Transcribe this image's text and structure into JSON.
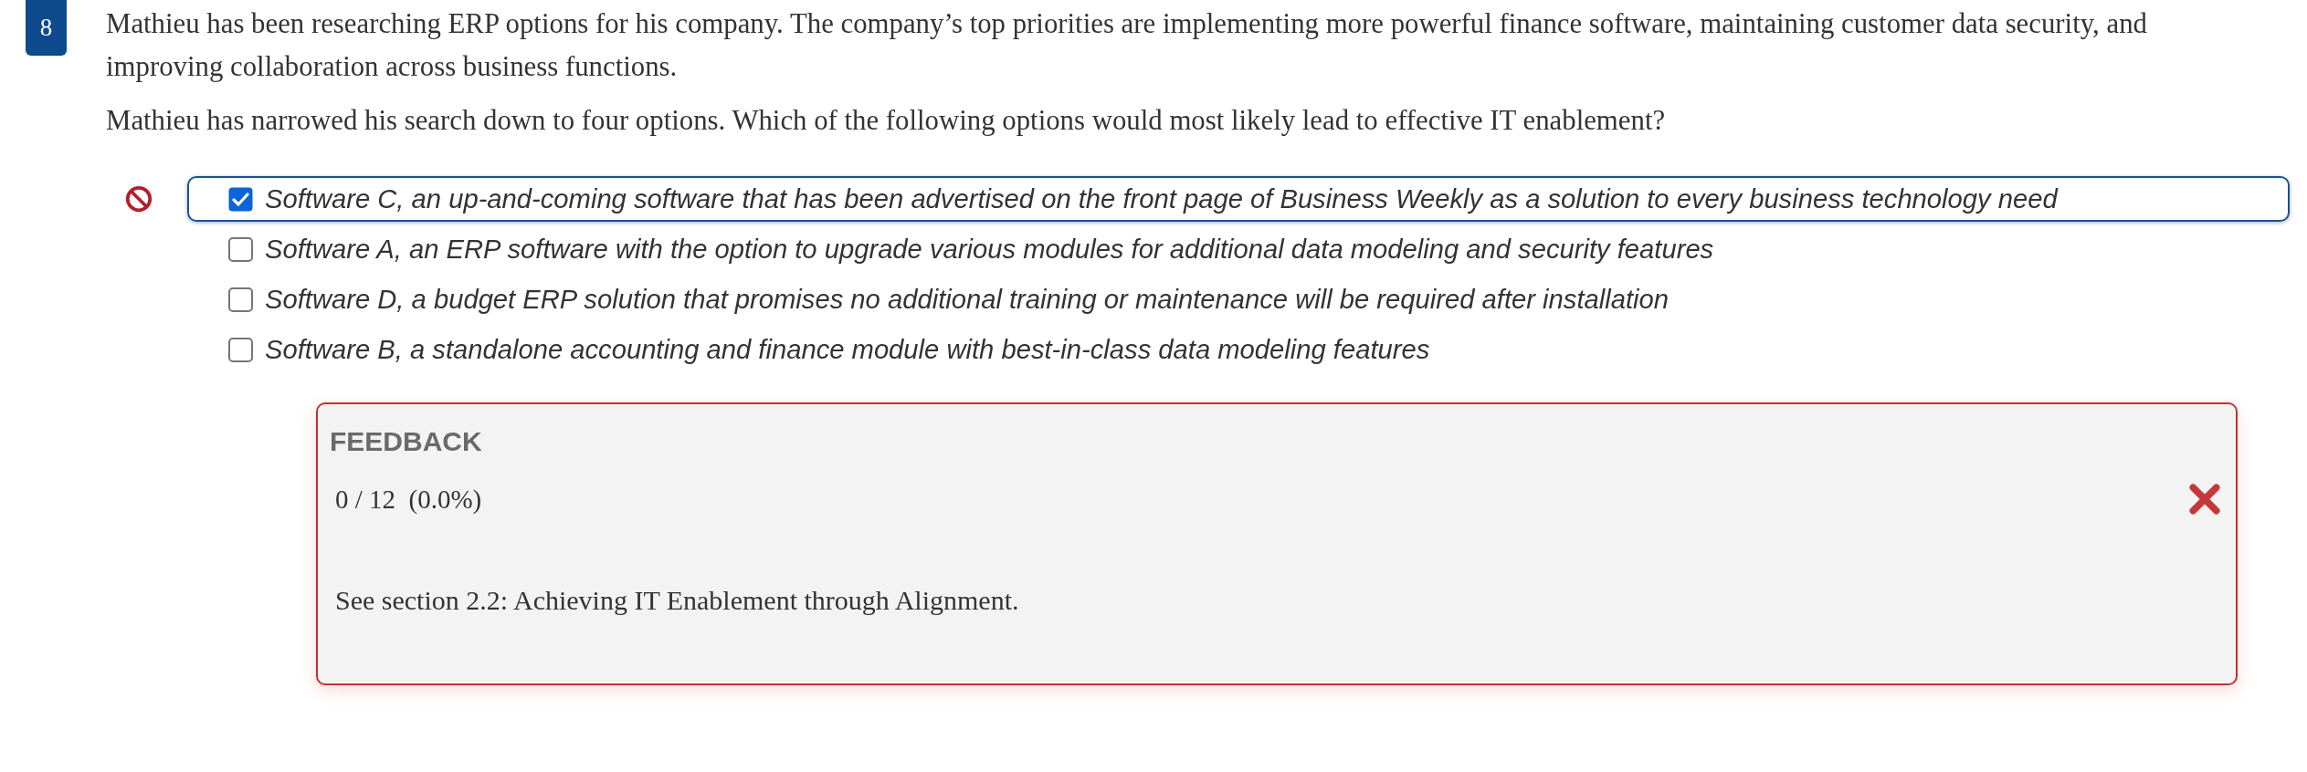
{
  "question": {
    "number": "8",
    "paragraphs": [
      "Mathieu has been researching ERP options for his company. The company’s top priorities are implementing more powerful finance software, maintaining customer data security, and improving collaboration across business functions.",
      "Mathieu has narrowed his search down to four options. Which of the following options would most likely lead to effective IT enablement?"
    ]
  },
  "options": [
    {
      "text": "Software C, an up-and-coming software that has been advertised on the front page of Business Weekly as a solution to every business technology need",
      "checked": true,
      "focused": true,
      "incorrect": true
    },
    {
      "text": "Software A, an ERP software with the option to upgrade various modules for additional data modeling and security features",
      "checked": false,
      "focused": false,
      "incorrect": false
    },
    {
      "text": "Software D, a budget ERP solution that promises no additional training or maintenance will be required after installation",
      "checked": false,
      "focused": false,
      "incorrect": false
    },
    {
      "text": "Software B, a standalone accounting and finance module with best-in-class data modeling features",
      "checked": false,
      "focused": false,
      "incorrect": false
    }
  ],
  "feedback": {
    "heading": "FEEDBACK",
    "score": "0 / 12  (0.0%)",
    "correct": false,
    "message": "See section 2.2: Achieving IT Enablement through Alignment."
  }
}
